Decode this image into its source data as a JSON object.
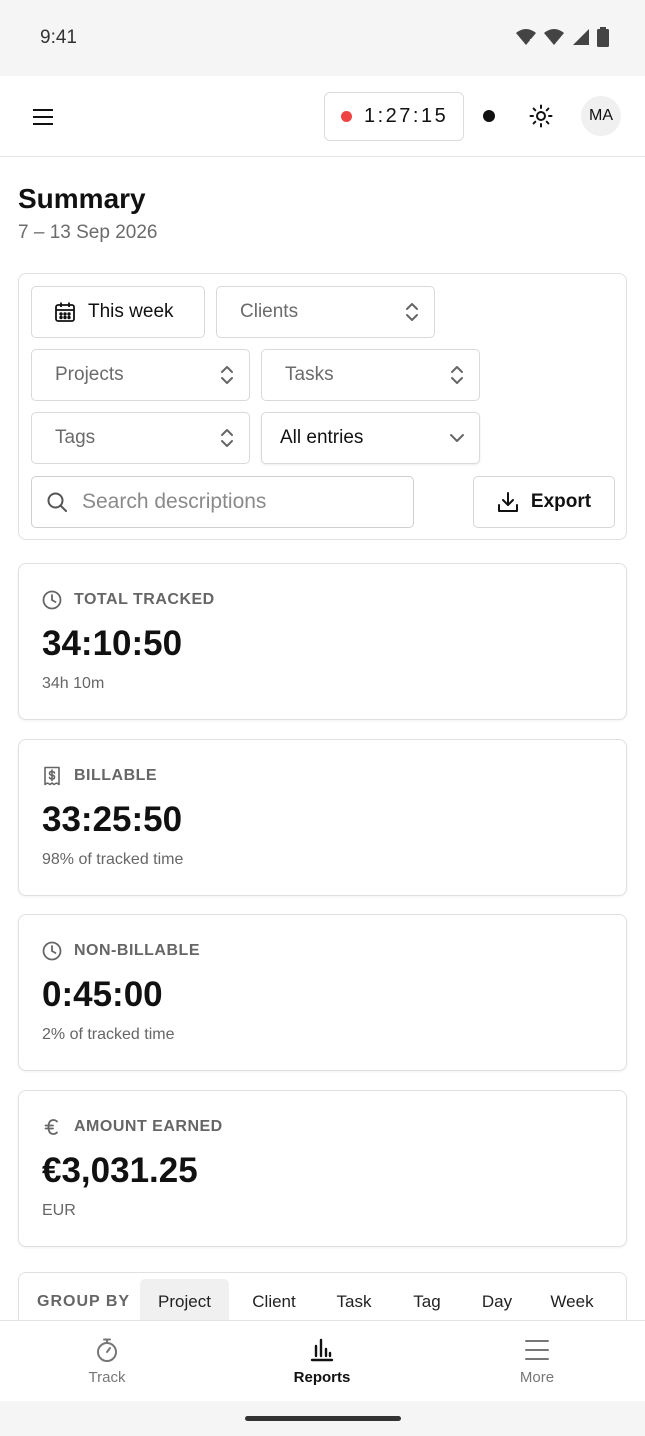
{
  "status_bar": {
    "time": "9:41"
  },
  "header": {
    "timer": "1:27:15",
    "avatar_initials": "MA",
    "timer_dot_color": "#ef4444"
  },
  "page": {
    "title": "Summary",
    "date_range": "7 – 13 Sep 2026"
  },
  "filters": {
    "date": "This week",
    "clients": "Clients",
    "projects": "Projects",
    "tasks": "Tasks",
    "tags": "Tags",
    "entries": "All entries",
    "search_placeholder": "Search descriptions",
    "export_label": "Export"
  },
  "cards": [
    {
      "icon": "clock-icon",
      "label": "TOTAL TRACKED",
      "value": "34:10:50",
      "sub": "34h 10m"
    },
    {
      "icon": "receipt-dollar-icon",
      "label": "BILLABLE",
      "value": "33:25:50",
      "sub": "98% of tracked time"
    },
    {
      "icon": "clock-icon",
      "label": "NON-BILLABLE",
      "value": "0:45:00",
      "sub": "2% of tracked time"
    },
    {
      "icon": "euro-icon",
      "label": "AMOUNT EARNED",
      "value": "€3,031.25",
      "sub": "EUR"
    }
  ],
  "group_by": {
    "label": "GROUP BY",
    "options": [
      "Project",
      "Client",
      "Task",
      "Tag",
      "Day",
      "Week"
    ],
    "selected": "Project"
  },
  "bottom_nav": [
    {
      "label": "Track",
      "icon": "stopwatch-icon",
      "active": false
    },
    {
      "label": "Reports",
      "icon": "bar-chart-icon",
      "active": true
    },
    {
      "label": "More",
      "icon": "menu-icon",
      "active": false
    }
  ]
}
